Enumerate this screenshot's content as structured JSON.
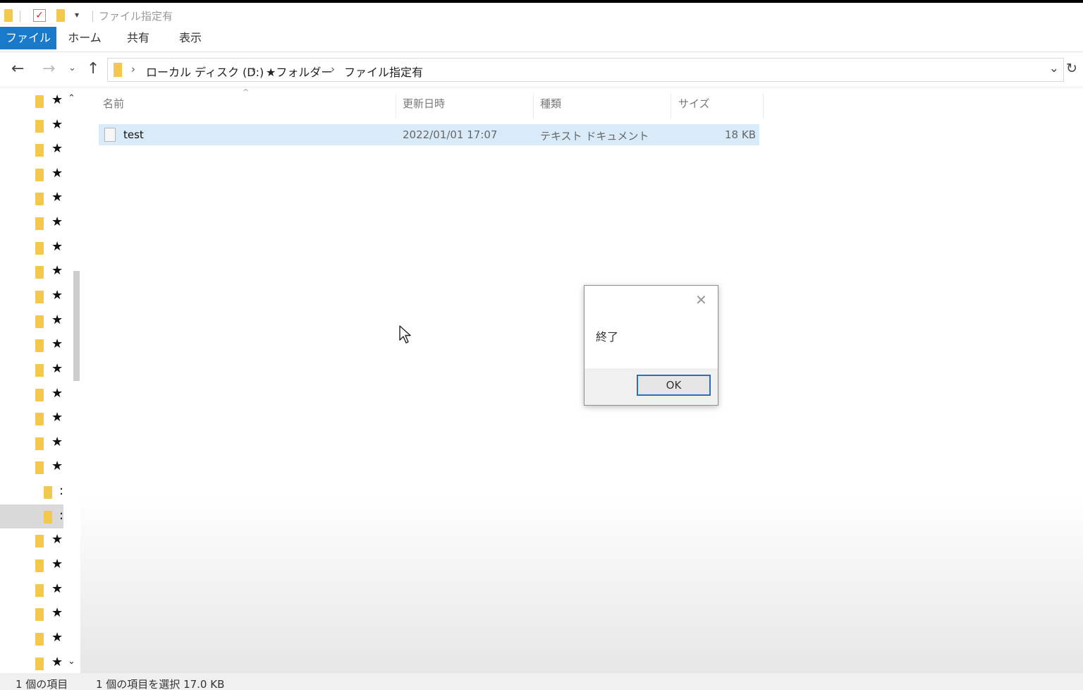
{
  "window": {
    "title": "ファイル指定有"
  },
  "ribbon": {
    "tabs": [
      {
        "label": "ファイル"
      },
      {
        "label": "ホーム"
      },
      {
        "label": "共有"
      },
      {
        "label": "表示"
      }
    ]
  },
  "address": {
    "crumbs": [
      "ローカル ディスク (D:)",
      "★フォルダー",
      "ファイル指定有"
    ]
  },
  "navpane": {
    "star": "★",
    "subitem": ":"
  },
  "columns": {
    "name": "名前",
    "date": "更新日時",
    "type": "種類",
    "size": "サイズ"
  },
  "files": [
    {
      "name": "test",
      "date": "2022/01/01 17:07",
      "type": "テキスト ドキュメント",
      "size": "18 KB"
    }
  ],
  "status": {
    "count": "1 個の項目",
    "selection": "1 個の項目を選択  17.0 KB"
  },
  "dialog": {
    "message": "終了",
    "ok_label": "OK"
  },
  "colors": {
    "accent": "#1979ca",
    "selection": "#cce4f7",
    "folder": "#f3c84c"
  }
}
